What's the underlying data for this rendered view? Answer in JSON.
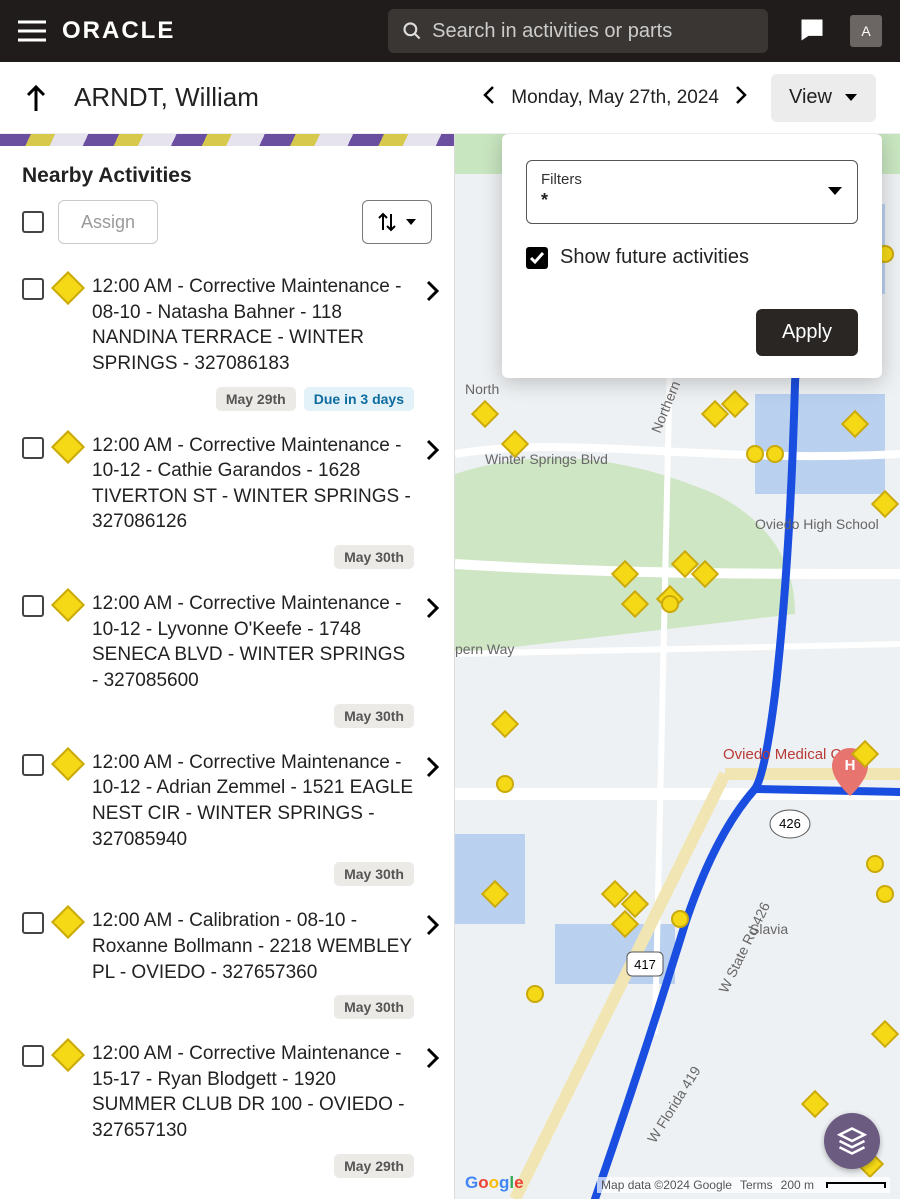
{
  "header": {
    "brand": "ORACLE",
    "search_placeholder": "Search in activities or parts",
    "avatar_initial": "A"
  },
  "subheader": {
    "page_title": "ARNDT, William",
    "date_label": "Monday, May 27th, 2024",
    "view_label": "View"
  },
  "nearby": {
    "title": "Nearby Activities",
    "assign_label": "Assign"
  },
  "filters_popover": {
    "field_label": "Filters",
    "field_value": "*",
    "show_future_label": "Show future activities",
    "show_future_checked": true,
    "apply_label": "Apply"
  },
  "activities": [
    {
      "text": "12:00 AM - Corrective Maintenance - 08-10 - Natasha Bahner - 118 NANDINA TERRACE - WINTER SPRINGS - 327086183",
      "date_tag": "May 29th",
      "due_tag": "Due in 3 days"
    },
    {
      "text": "12:00 AM - Corrective Maintenance - 10-12 - Cathie Garandos - 1628 TIVERTON ST - WINTER SPRINGS - 327086126",
      "date_tag": "May 30th",
      "due_tag": ""
    },
    {
      "text": "12:00 AM - Corrective Maintenance - 10-12 - Lyvonne O'Keefe - 1748 SENECA BLVD - WINTER SPRINGS - 327085600",
      "date_tag": "May 30th",
      "due_tag": ""
    },
    {
      "text": "12:00 AM - Corrective Maintenance - 10-12 - Adrian Zemmel - 1521 EAGLE NEST CIR - WINTER SPRINGS - 327085940",
      "date_tag": "May 30th",
      "due_tag": ""
    },
    {
      "text": "12:00 AM - Calibration - 08-10 - Roxanne Bollmann - 2218 WEMBLEY PL - OVIEDO - 327657360",
      "date_tag": "May 30th",
      "due_tag": ""
    },
    {
      "text": "12:00 AM - Corrective Maintenance - 15-17 - Ryan Blodgett - 1920 SUMMER CLUB DR 100 - OVIEDO - 327657130",
      "date_tag": "May 29th",
      "due_tag": ""
    }
  ],
  "map": {
    "labels": {
      "winter_springs": "Winter Springs Blvd",
      "northern": "Northern Way",
      "oviedo_hs": "Oviedo High School",
      "oviedo_med": "Oviedo Medical Ctr",
      "slavia": "Slavia",
      "sr426": "W State Rd 426",
      "florida419": "W Florida 419",
      "route426": "426",
      "route417": "417",
      "pern": "pern Way",
      "north": "North"
    },
    "attribution": "Map data ©2024 Google",
    "terms": "Terms",
    "scale": "200 m",
    "google": "Google"
  }
}
